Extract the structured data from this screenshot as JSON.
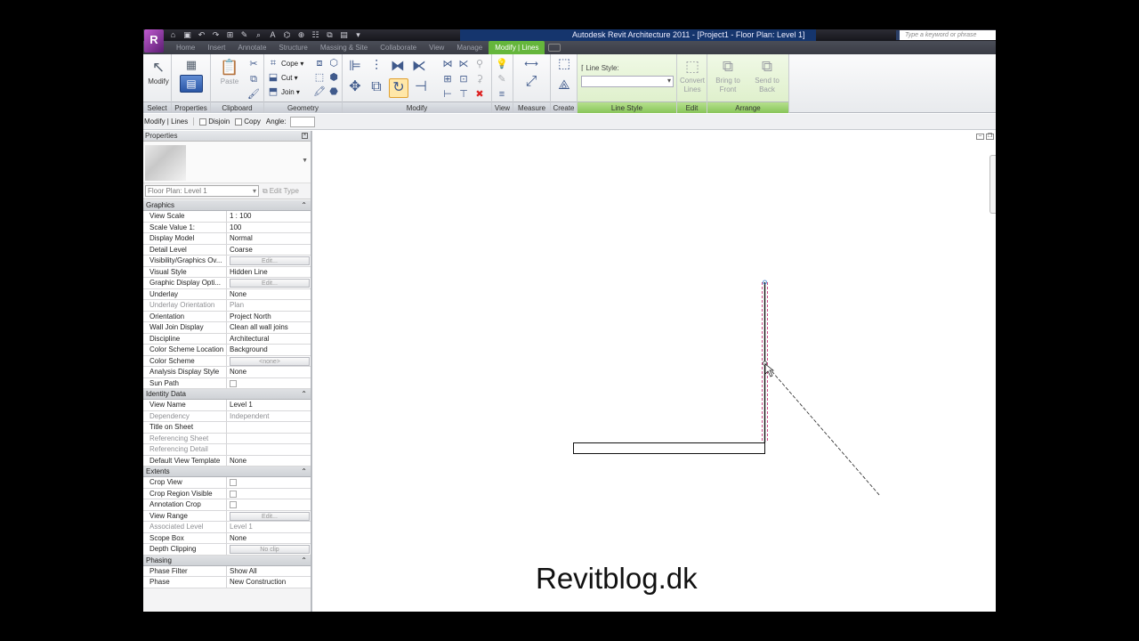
{
  "app_button": "R",
  "qat_icons": [
    "open-icon",
    "save-icon",
    "undo-icon",
    "redo-icon",
    "measure-icon",
    "text-icon",
    "3d-view-icon",
    "section-icon",
    "thin-lines-icon",
    "close-windows-icon",
    "switch-windows-icon"
  ],
  "window_title": "Autodesk Revit Architecture 2011 - [Project1 - Floor Plan: Level 1]",
  "search_placeholder": "Type a keyword or phrase",
  "tabs": [
    "Home",
    "Insert",
    "Annotate",
    "Structure",
    "Massing & Site",
    "Collaborate",
    "View",
    "Manage",
    "Modify | Lines"
  ],
  "active_tab": "Modify | Lines",
  "ribbon": {
    "select": {
      "title": "Select",
      "modify": "Modify"
    },
    "properties": {
      "title": "Properties",
      "label": "Properties"
    },
    "clipboard": {
      "title": "Clipboard",
      "paste": "Paste"
    },
    "geometry": {
      "title": "Geometry",
      "cope": "Cope",
      "cut": "Cut",
      "join": "Join"
    },
    "modify": {
      "title": "Modify"
    },
    "view": {
      "title": "View"
    },
    "measure": {
      "title": "Measure"
    },
    "create": {
      "title": "Create"
    },
    "line_style": {
      "title": "Line Style",
      "label": "Line Style:"
    },
    "edit": {
      "title": "Edit",
      "convert": "Convert Lines"
    },
    "arrange": {
      "title": "Arrange",
      "bring_to_front": "Bring to Front",
      "send_to_back": "Send to Back"
    }
  },
  "options_bar": {
    "context": "Modify | Lines",
    "disjoin": "Disjoin",
    "copy": "Copy",
    "angle": "Angle:"
  },
  "properties": {
    "title": "Properties",
    "instance": "Floor Plan: Level 1",
    "edit_type": "Edit Type",
    "groups": [
      {
        "name": "Graphics",
        "rows": [
          {
            "name": "View Scale",
            "value": "1 : 100"
          },
          {
            "name": "Scale Value    1:",
            "value": "100"
          },
          {
            "name": "Display Model",
            "value": "Normal"
          },
          {
            "name": "Detail Level",
            "value": "Coarse"
          },
          {
            "name": "Visibility/Graphics Ov...",
            "value": "Edit...",
            "button": true
          },
          {
            "name": "Visual Style",
            "value": "Hidden Line"
          },
          {
            "name": "Graphic Display Opti...",
            "value": "Edit...",
            "button": true
          },
          {
            "name": "Underlay",
            "value": "None"
          },
          {
            "name": "Underlay Orientation",
            "value": "Plan",
            "grey": true
          },
          {
            "name": "Orientation",
            "value": "Project North"
          },
          {
            "name": "Wall Join Display",
            "value": "Clean all wall joins"
          },
          {
            "name": "Discipline",
            "value": "Architectural"
          },
          {
            "name": "Color Scheme Location",
            "value": "Background"
          },
          {
            "name": "Color Scheme",
            "value": "<none>",
            "button": true
          },
          {
            "name": "Analysis Display Style",
            "value": "None"
          },
          {
            "name": "Sun Path",
            "value": "",
            "checkbox": true
          }
        ]
      },
      {
        "name": "Identity Data",
        "rows": [
          {
            "name": "View Name",
            "value": "Level 1"
          },
          {
            "name": "Dependency",
            "value": "Independent",
            "grey": true
          },
          {
            "name": "Title on Sheet",
            "value": ""
          },
          {
            "name": "Referencing Sheet",
            "value": "",
            "grey": true
          },
          {
            "name": "Referencing Detail",
            "value": "",
            "grey": true
          },
          {
            "name": "Default View Template",
            "value": "None"
          }
        ]
      },
      {
        "name": "Extents",
        "rows": [
          {
            "name": "Crop View",
            "value": "",
            "checkbox": true
          },
          {
            "name": "Crop Region Visible",
            "value": "",
            "checkbox": true
          },
          {
            "name": "Annotation Crop",
            "value": "",
            "checkbox": true
          },
          {
            "name": "View Range",
            "value": "Edit...",
            "button": true
          },
          {
            "name": "Associated Level",
            "value": "Level 1",
            "grey": true
          },
          {
            "name": "Scope Box",
            "value": "None"
          },
          {
            "name": "Depth Clipping",
            "value": "No clip",
            "button": true
          }
        ]
      },
      {
        "name": "Phasing",
        "rows": [
          {
            "name": "Phase Filter",
            "value": "Show All"
          },
          {
            "name": "Phase",
            "value": "New Construction"
          }
        ]
      }
    ]
  },
  "watermark": "Revitblog.dk",
  "colors": {
    "active_tab": "#65b63c",
    "selection": "#c0206e",
    "title_bar": "#15356d"
  }
}
